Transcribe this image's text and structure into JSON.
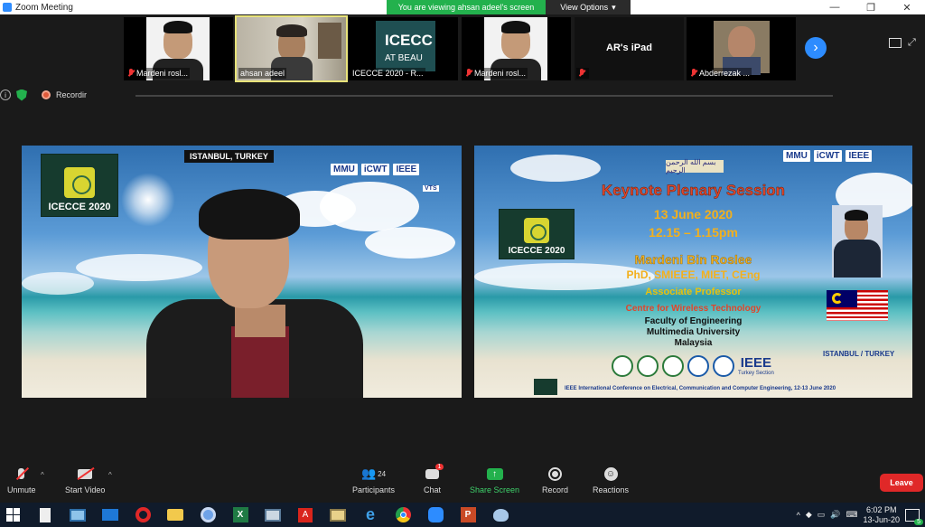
{
  "window": {
    "title": "Zoom Meeting",
    "viewing_banner": "You are viewing ahsan adeel's screen",
    "view_options": "View Options"
  },
  "participants_strip": [
    {
      "name": "Mardeni rosl...",
      "muted": true
    },
    {
      "name": "ahsan adeel",
      "muted": false
    },
    {
      "name": "ICECCE 2020 - R...",
      "muted": false,
      "display_text": "ICECC",
      "display_sub": "AT BEAU"
    },
    {
      "name": "Mardeni rosl...",
      "muted": true
    },
    {
      "name": "",
      "muted": true,
      "display_text": "AR's iPad"
    },
    {
      "name": "Abderrezak ...",
      "muted": true
    }
  ],
  "status": {
    "recording": "Recordir"
  },
  "left_video": {
    "tag": "ISTANBUL, TURKEY",
    "logo": "ICECCE 2020",
    "sponsors": [
      "MMU",
      "iCWT",
      "IEEE"
    ],
    "sponsor_sub": "VTS"
  },
  "right_slide": {
    "arabic_banner": "بسم الله الرحمن الرحيم",
    "sponsors": [
      "MMU",
      "iCWT",
      "IEEE"
    ],
    "title": "Keynote Plenary Session",
    "date": "13 June 2020",
    "time": "12.15 – 1.15pm",
    "logo": "ICECCE 2020",
    "speaker": "Mardeni Bin Roslee",
    "credentials": "PhD, SMIEEE, MIET, CEng",
    "position": "Associate Professor",
    "centre": "Centre for Wireless Technology",
    "faculty": "Faculty of Engineering",
    "university": "Multimedia University",
    "country": "Malaysia",
    "location": "ISTANBUL / TURKEY",
    "ieee": "IEEE",
    "ieee_sub": "Turkey Section",
    "footer": "IEEE International Conference on Electrical, Communication and Computer Engineering, 12-13 June 2020"
  },
  "controls": {
    "unmute": "Unmute",
    "start_video": "Start Video",
    "participants": "Participants",
    "participants_count": "24",
    "chat": "Chat",
    "chat_badge": "1",
    "share_screen": "Share Screen",
    "record": "Record",
    "reactions": "Reactions",
    "leave": "Leave"
  },
  "taskbar": {
    "time": "6:02 PM",
    "date": "13-Jun-20",
    "notifications": "5"
  },
  "colors": {
    "zoom_blue": "#2d8cff",
    "share_green": "#23b14d",
    "leave_red": "#e02828",
    "slide_title": "#e0452a",
    "slide_gold": "#f3b01c"
  }
}
